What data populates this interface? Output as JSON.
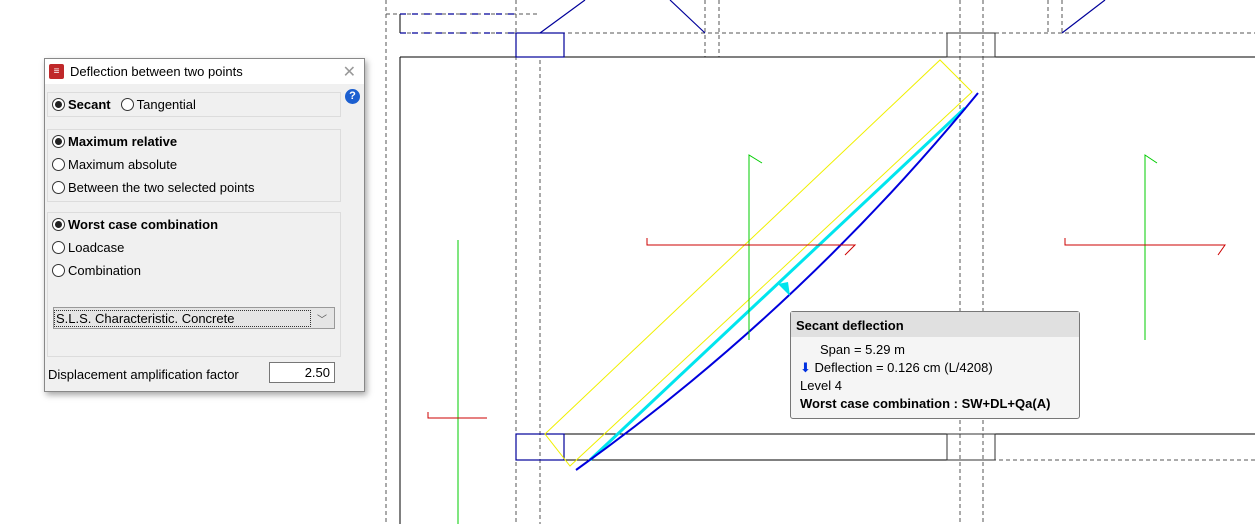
{
  "dialog": {
    "title": "Deflection between two points",
    "method_options": [
      {
        "label": "Secant",
        "selected": true
      },
      {
        "label": "Tangential",
        "selected": false
      }
    ],
    "type_options": [
      {
        "label": "Maximum relative",
        "selected": true
      },
      {
        "label": "Maximum absolute",
        "selected": false
      },
      {
        "label": "Between the two selected points",
        "selected": false
      }
    ],
    "load_options": [
      {
        "label": "Worst case combination",
        "selected": true
      },
      {
        "label": "Loadcase",
        "selected": false
      },
      {
        "label": "Combination",
        "selected": false
      }
    ],
    "combination_select": "S.L.S. Characteristic. Concrete",
    "amplification_label": "Displacement amplification factor",
    "amplification_value": "2.50",
    "help_icon": "?"
  },
  "tooltip": {
    "title": "Secant deflection",
    "span": "Span = 5.29 m",
    "deflection": "Deflection = 0.126 cm (L/4208)",
    "level": "Level 4",
    "combination": "Worst case combination : SW+DL+Qa(A)"
  },
  "colors": {
    "deflection_curve": "#0000dd",
    "secant_line": "#00e5ee",
    "strip": "#f0f000",
    "axis_green": "#00cc00",
    "axis_red": "#cc0000"
  }
}
